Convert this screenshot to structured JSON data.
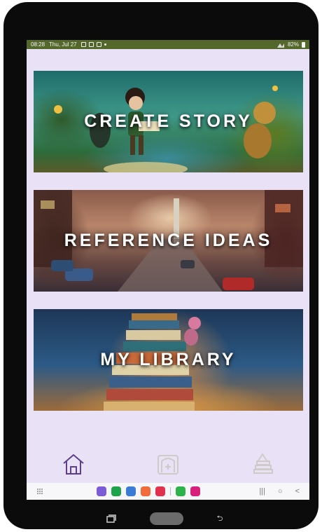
{
  "status_bar": {
    "time": "08:28",
    "date": "Thu, Jul 27",
    "battery": "82%"
  },
  "cards": {
    "create": {
      "title": "CREATE STORY"
    },
    "reference": {
      "title": "REFERENCE IDEAS"
    },
    "library": {
      "title": "MY LIBRARY"
    }
  },
  "bottom_nav": {
    "items": [
      "home-icon",
      "storybook-icon",
      "library-books-icon"
    ],
    "active_index": 0
  },
  "colors": {
    "status_bar": "#55682c",
    "screen_bg": "#e9e2f6",
    "active_nav": "#5c3f8e",
    "inactive_nav": "#cfcac6"
  },
  "system_dock": {
    "apps": [
      "#7b5cd6",
      "#1fa34a",
      "#3a7bd5",
      "#f26b3a",
      "#e0314e",
      "#2fb24a",
      "#d6207a"
    ]
  }
}
